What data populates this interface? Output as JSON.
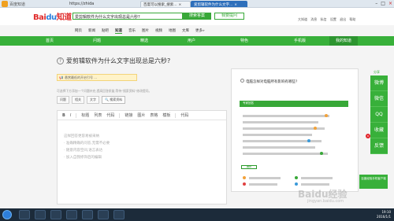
{
  "browser": {
    "tab_prefix": "百度知道",
    "url": "https://zhida",
    "tabs": [
      {
        "label": "百度可以搜索_搜索..."
      },
      {
        "label": "爱剪辑软件为什么文字..."
      }
    ]
  },
  "site": {
    "logo_red": "Bai",
    "logo_blue": "du",
    "logo_suffix": "知道",
    "search_value": "爱剪辑软件为什么文字出现总是六秒?",
    "search_button": "搜索答案",
    "ask_button": "我要提问",
    "user_links": [
      "大知道",
      "消息",
      "私信",
      "设置",
      "退出",
      "帮助"
    ]
  },
  "sub_nav": [
    "网页",
    "新闻",
    "贴吧",
    "知道",
    "音乐",
    "图片",
    "视频",
    "地图",
    "文库",
    "更多»"
  ],
  "sub_nav_active": "知道",
  "green_nav": {
    "items": [
      "首页",
      "问题",
      "精选",
      "用户",
      "特色",
      "手机版",
      "我的知道"
    ],
    "active": "我的知道"
  },
  "question": {
    "title": "爱剪辑软件为什么文字出现总是六秒?",
    "reward_text": "悬赏最低的开启引号 ...",
    "hint": "可选择下方添加一个问题补充,提高回答质量,等待“搜索资料”修改提问。",
    "tags": [
      "问题",
      "相关",
      "文字"
    ],
    "search_resource": "搜索资料"
  },
  "editor": {
    "toolbar": [
      "B",
      "I",
      "标题",
      "列表",
      "代码",
      "链接",
      "图片",
      "表格",
      "模板",
      "代码"
    ],
    "placeholder_lines": [
      "这样回答更容易被采纳",
      "· 准确精确的问答,无需不必要",
      "· 随意内容空间,语言表达",
      "· 加入自我修饰后的编辑"
    ]
  },
  "right_card": {
    "title": "电脑怎样对电脑所有影响有哪些?",
    "header_label": "专家回答",
    "highlight": "推荐"
  },
  "sidebar": {
    "top_label": "分享",
    "items": [
      "微博",
      "微信",
      "QQ",
      "收藏",
      "反馈"
    ],
    "badge": "8"
  },
  "watermark": {
    "title": "Baidu经验",
    "sub": "jingyan.baidu.com"
  },
  "qr_hint": "百度经验手机客户端",
  "taskbar": {
    "time": "19:10",
    "date": "2016/1/1"
  }
}
